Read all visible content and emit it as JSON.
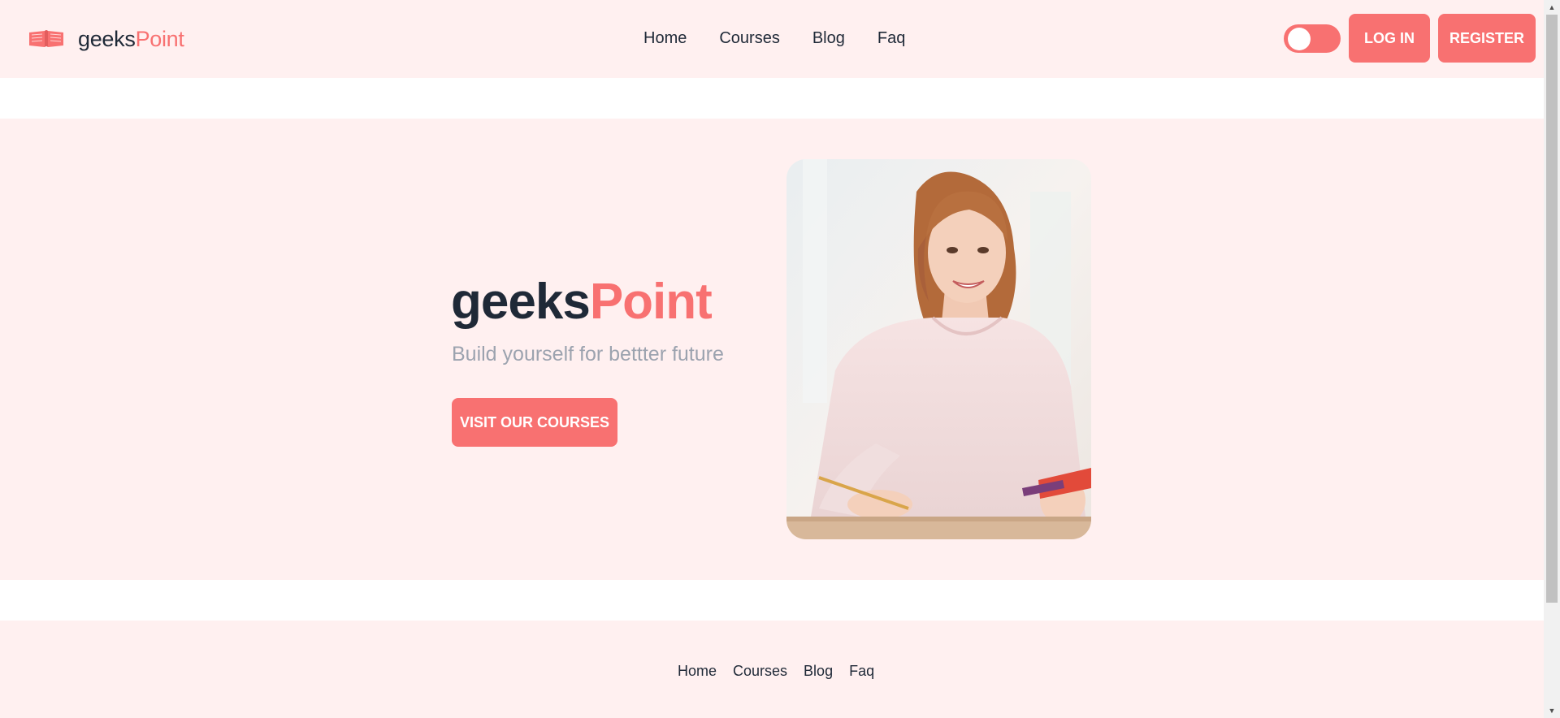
{
  "brand": {
    "name_part1": "geeks",
    "name_part2": "Point",
    "icon": "open-book-icon"
  },
  "nav": {
    "links": [
      {
        "label": "Home"
      },
      {
        "label": "Courses"
      },
      {
        "label": "Blog"
      },
      {
        "label": "Faq"
      }
    ],
    "theme_toggle": {
      "state": "off"
    },
    "login_label": "LOG IN",
    "register_label": "REGISTER"
  },
  "hero": {
    "title_part1": "geeks",
    "title_part2": "Point",
    "subtitle": "Build yourself for bettter future",
    "cta_label": "VISIT OUR COURSES",
    "image": "smiling-student-photo"
  },
  "footer": {
    "links": [
      {
        "label": "Home"
      },
      {
        "label": "Courses"
      },
      {
        "label": "Blog"
      },
      {
        "label": "Faq"
      }
    ]
  },
  "colors": {
    "accent": "#f87171",
    "section_bg": "#fff0f0",
    "text_dark": "#1f2937",
    "text_muted": "#9ca3af"
  }
}
